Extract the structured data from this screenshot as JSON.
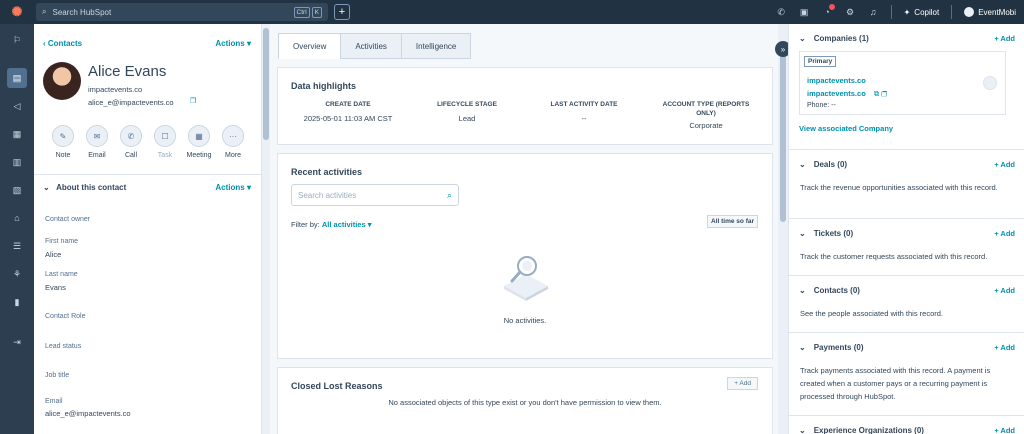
{
  "topbar": {
    "search_placeholder": "Search HubSpot",
    "shortcut_keys": [
      "Ctrl",
      "K"
    ],
    "copilot_label": "Copilot",
    "account_name": "EventMobi"
  },
  "contact": {
    "back_label": "Contacts",
    "actions_label": "Actions",
    "name": "Alice Evans",
    "domain": "impactevents.co",
    "email": "alice_e@impactevents.co"
  },
  "quick_actions": [
    {
      "label": "Note",
      "icon": "note-icon"
    },
    {
      "label": "Email",
      "icon": "email-icon"
    },
    {
      "label": "Call",
      "icon": "call-icon"
    },
    {
      "label": "Task",
      "icon": "task-icon"
    },
    {
      "label": "Meeting",
      "icon": "meeting-icon"
    },
    {
      "label": "More",
      "icon": "more-icon"
    }
  ],
  "about": {
    "title": "About this contact",
    "actions_label": "Actions",
    "fields": [
      {
        "label": "Contact owner",
        "value": ""
      },
      {
        "label": "First name",
        "value": "Alice"
      },
      {
        "label": "Last name",
        "value": "Evans"
      },
      {
        "label": "Contact Role",
        "value": ""
      },
      {
        "label": "Lead status",
        "value": ""
      },
      {
        "label": "Job title",
        "value": ""
      },
      {
        "label": "Email",
        "value": "alice_e@impactevents.co"
      }
    ]
  },
  "tabs": [
    "Overview",
    "Activities",
    "Intelligence"
  ],
  "highlights": {
    "title": "Data highlights",
    "columns": [
      {
        "header": "CREATE DATE",
        "value": "2025-05-01 11:03 AM CST"
      },
      {
        "header": "LIFECYCLE STAGE",
        "value": "Lead"
      },
      {
        "header": "LAST ACTIVITY DATE",
        "value": "--"
      },
      {
        "header": "ACCOUNT TYPE (REPORTS ONLY)",
        "value": "Corporate"
      }
    ]
  },
  "recent": {
    "title": "Recent activities",
    "search_placeholder": "Search activities",
    "filter_label": "Filter by:",
    "filter_value": "All activities",
    "time_button": "All time so far",
    "empty_text": "No activities."
  },
  "closed_lost": {
    "title": "Closed Lost Reasons",
    "add_label": "+ Add",
    "message": "No associated objects of this type exist or you don't have permission to view them."
  },
  "right": {
    "add_label": "+ Add",
    "companies": {
      "title": "Companies (1)",
      "primary_tag": "Primary",
      "name": "impactevents.co",
      "domain": "impactevents.co",
      "phone": "Phone: --",
      "view_link": "View associated Company"
    },
    "sections": [
      {
        "title": "Deals (0)",
        "desc": "Track the revenue opportunities associated with this record."
      },
      {
        "title": "Tickets (0)",
        "desc": "Track the customer requests associated with this record."
      },
      {
        "title": "Contacts (0)",
        "desc": "See the people associated with this record."
      },
      {
        "title": "Payments (0)",
        "desc": "Track payments associated with this record. A payment is created when a customer pays or a recurring payment is processed through HubSpot."
      },
      {
        "title": "Experience Organizations (0)",
        "desc": ""
      }
    ]
  },
  "colors": {
    "topbar": "#213343",
    "nav": "#2d3e50",
    "link": "#0091ae",
    "text": "#33475b",
    "brand_orange": "#ff7a59"
  }
}
